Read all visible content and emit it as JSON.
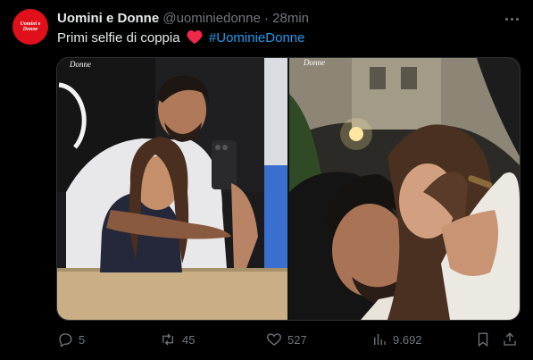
{
  "author": {
    "avatar_text": "Uomini e Donne",
    "name": "Uomini e Donne",
    "handle": "@uominiedonne",
    "separator": "·",
    "time": "28min"
  },
  "tweet": {
    "text": "Primi selfie di coppia",
    "emoji": "red-heart",
    "hashtag": "#UominieDonne"
  },
  "media": {
    "watermark_1": "Donne",
    "watermark_2": "Donne"
  },
  "actions": {
    "replies": "5",
    "reposts": "45",
    "likes": "527",
    "views": "9.692"
  },
  "colors": {
    "background": "#000000",
    "text": "#e7e9ea",
    "muted": "#71767b",
    "link": "#1d9bf0",
    "avatar_bg": "#e0101a",
    "heart": "#f91880"
  }
}
